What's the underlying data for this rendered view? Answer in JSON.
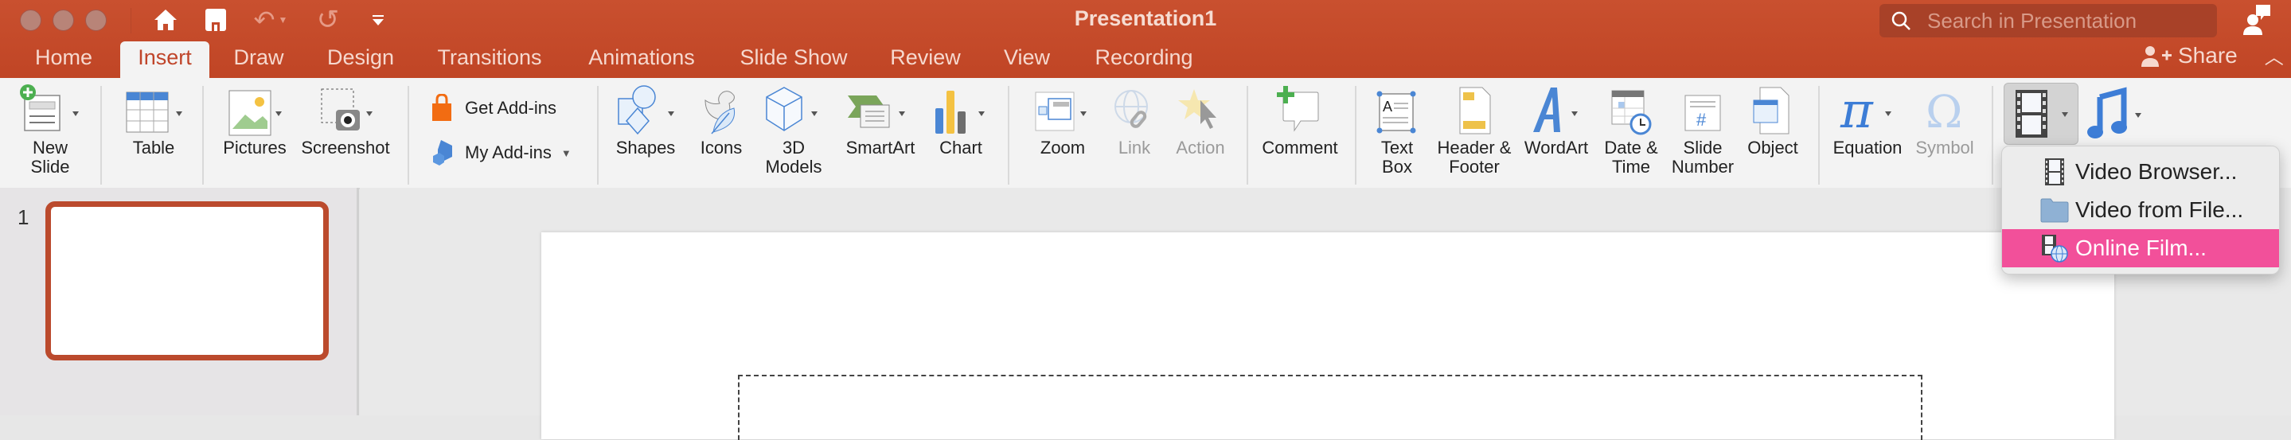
{
  "window": {
    "title": "Presentation1",
    "controls": [
      "close",
      "minimize",
      "zoom"
    ],
    "quick_access": [
      {
        "name": "home-icon",
        "glyph": "⌂"
      },
      {
        "name": "save-icon",
        "glyph": "💾"
      },
      {
        "name": "undo-icon",
        "glyph": "↶"
      },
      {
        "name": "redo-icon",
        "glyph": "↺"
      },
      {
        "name": "customize-icon",
        "glyph": "▾"
      }
    ]
  },
  "search": {
    "placeholder": "Search in Presentation"
  },
  "tabs": [
    {
      "label": "Home"
    },
    {
      "label": "Insert",
      "active": true
    },
    {
      "label": "Draw"
    },
    {
      "label": "Design"
    },
    {
      "label": "Transitions"
    },
    {
      "label": "Animations"
    },
    {
      "label": "Slide Show"
    },
    {
      "label": "Review"
    },
    {
      "label": "View"
    },
    {
      "label": "Recording"
    }
  ],
  "share": {
    "label": "Share"
  },
  "ribbon": {
    "new_slide": {
      "line1": "New",
      "line2": "Slide"
    },
    "table": "Table",
    "pictures": "Pictures",
    "screenshot": "Screenshot",
    "get_addins": "Get Add-ins",
    "my_addins": "My Add-ins",
    "shapes": "Shapes",
    "icons": "Icons",
    "models_3d": {
      "line1": "3D",
      "line2": "Models"
    },
    "smartart": "SmartArt",
    "chart": "Chart",
    "zoom": "Zoom",
    "link": "Link",
    "action": "Action",
    "comment": "Comment",
    "text_box": {
      "line1": "Text",
      "line2": "Box"
    },
    "header_footer": {
      "line1": "Header &",
      "line2": "Footer"
    },
    "wordart": "WordArt",
    "date_time": {
      "line1": "Date &",
      "line2": "Time"
    },
    "slide_number": {
      "line1": "Slide",
      "line2": "Number"
    },
    "object": "Object",
    "equation": "Equation",
    "symbol": "Symbol"
  },
  "video_menu": {
    "items": [
      {
        "label": "Video Browser...",
        "icon": "film-icon"
      },
      {
        "label": "Video from File...",
        "icon": "folder-icon"
      },
      {
        "label": "Online Film...",
        "icon": "online-film-icon",
        "highlighted": true
      }
    ]
  },
  "slides_panel": {
    "slides": [
      {
        "number": "1"
      }
    ]
  },
  "colors": {
    "accent": "#c4492a",
    "menu_highlight": "#f2509a"
  }
}
